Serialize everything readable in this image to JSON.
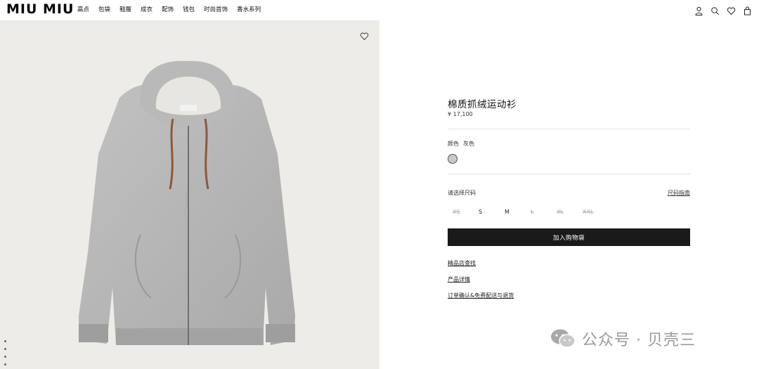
{
  "header": {
    "logo": "MIU MIU",
    "nav": [
      "高点",
      "包袋",
      "鞋履",
      "成衣",
      "配饰",
      "钱包",
      "时尚首饰",
      "香水系列"
    ],
    "icons": [
      "user-icon",
      "search-icon",
      "heart-icon",
      "bag-icon"
    ]
  },
  "gallery": {
    "image": "grey-zip-hoodie",
    "dots": 5
  },
  "product": {
    "title": "棉质抓绒运动衫",
    "price": "¥ 17,100",
    "color_label": "颜色",
    "color_value": "灰色",
    "swatch_color": "#c9c9c9",
    "size_label": "请选择尺码",
    "size_guide": "尺码指南",
    "sizes": [
      {
        "label": "XS",
        "available": false
      },
      {
        "label": "S",
        "available": true
      },
      {
        "label": "M",
        "available": true
      },
      {
        "label": "L",
        "available": false
      },
      {
        "label": "XL",
        "available": false
      },
      {
        "label": "XXL",
        "available": false
      }
    ],
    "add_to_bag": "加入购物袋",
    "links": [
      "精品店查找",
      "产品详情",
      "订单确认&免费配送与退货"
    ]
  },
  "watermark": {
    "text": "公众号 · 贝壳三"
  }
}
